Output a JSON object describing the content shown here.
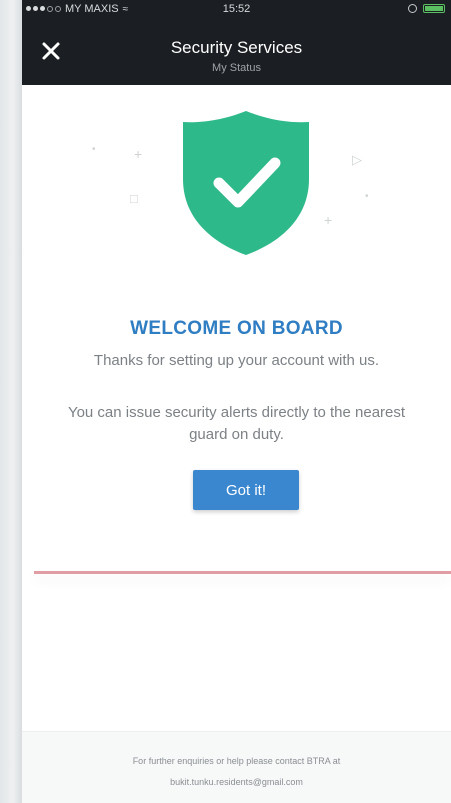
{
  "status_bar": {
    "carrier": "MY MAXIS",
    "time": "15:52"
  },
  "header": {
    "title": "Security Services",
    "subtitle": "My Status"
  },
  "icons": {
    "close": "close-icon",
    "shield": "shield-check-icon"
  },
  "colors": {
    "header_bg": "#1b1f23",
    "shield_green": "#2eb98b",
    "title_blue": "#2f7dc2",
    "button_blue": "#3a87cf",
    "divider_pink": "#e29ca4"
  },
  "main": {
    "title": "WELCOME ON BOARD",
    "thanks": "Thanks for setting up your account with us.",
    "info": "You can issue security alerts directly to the nearest guard on duty.",
    "button_label": "Got it!"
  },
  "footer": {
    "line1": "For further enquiries or help please contact BTRA at",
    "email": "bukit.tunku.residents@gmail.com"
  }
}
